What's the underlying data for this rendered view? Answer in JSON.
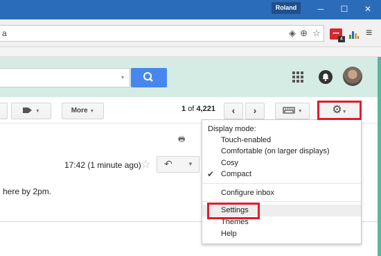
{
  "window": {
    "user_name": "Roland",
    "minimize_label": "─",
    "maximize_label": "☐",
    "close_label": "✕"
  },
  "browser": {
    "address_value": "a",
    "menu_glyph": "≡",
    "extension_badge": "4"
  },
  "gmail": {
    "pager_range": "1",
    "pager_of": "of",
    "pager_total": "4,221",
    "more_label": "More",
    "message": {
      "timestamp": "17:42 (1 minute ago)",
      "body_snippet": "here by 2pm."
    },
    "settings_menu": {
      "header": "Display mode:",
      "display_modes": [
        {
          "label": "Touch-enabled",
          "checked": false
        },
        {
          "label": "Comfortable (on larger displays)",
          "checked": false
        },
        {
          "label": "Cosy",
          "checked": false
        },
        {
          "label": "Compact",
          "checked": true
        }
      ],
      "configure_inbox": "Configure inbox",
      "settings": "Settings",
      "themes": "Themes",
      "help": "Help"
    }
  },
  "colors": {
    "accent_blue": "#4787ed",
    "header_green": "#d5ece4",
    "highlight_red": "#e21b2b",
    "titlebar_blue": "#2b6cb8"
  }
}
